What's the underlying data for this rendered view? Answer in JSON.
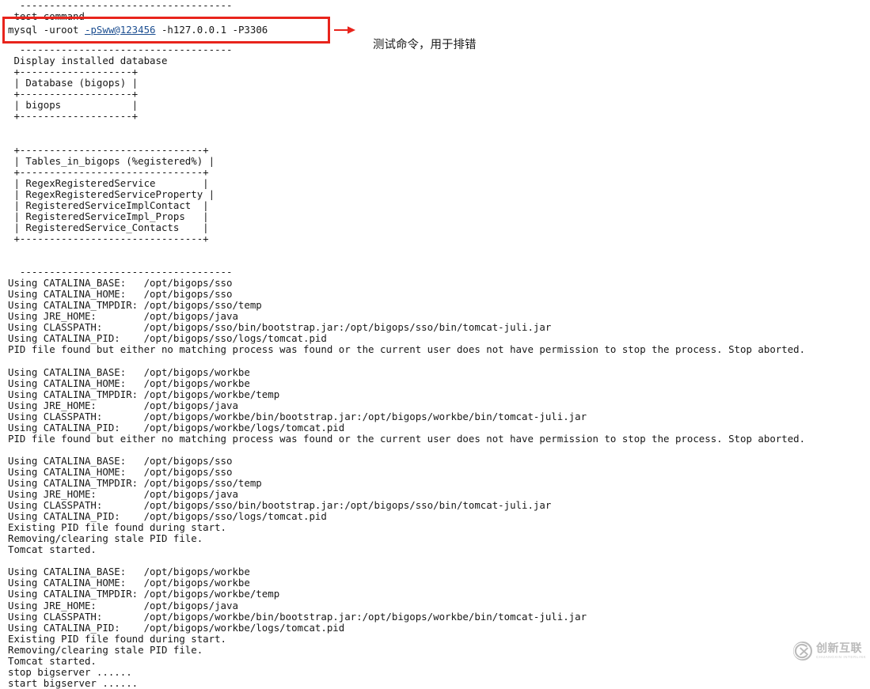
{
  "window": {
    "background_color": "#ffffff",
    "text_color": "#171717",
    "type": "terminal-output"
  },
  "annotation": {
    "box_color": "#e8241c",
    "arrow_color": "#e8241c",
    "note_text": "测试命令，用于排错"
  },
  "command": {
    "prefix": "mysql -uroot ",
    "link_text": "-pSww@123456",
    "suffix": " -h127.0.0.1 -P3306",
    "link_color": "#1d4f91"
  },
  "watermark": {
    "cn": "创新互联",
    "en": "CHUANGXIN INTERLINK",
    "color": "#8a8a8a"
  },
  "terminal": {
    "lines": [
      "  ------------------------------------",
      " test command",
      " mysql -uroot -pSww@123456 -h127.0.0.1 -P3306",
      "",
      "  ------------------------------------",
      " Display installed database",
      " +-------------------+",
      " | Database (bigops) |",
      " +-------------------+",
      " | bigops            |",
      " +-------------------+",
      "",
      "",
      " +-------------------------------+",
      " | Tables_in_bigops (%egistered%) |",
      " +-------------------------------+",
      " | RegexRegisteredService        |",
      " | RegexRegisteredServiceProperty |",
      " | RegisteredServiceImplContact  |",
      " | RegisteredServiceImpl_Props   |",
      " | RegisteredService_Contacts    |",
      " +-------------------------------+",
      "",
      "",
      "  ------------------------------------",
      "Using CATALINA_BASE:   /opt/bigops/sso",
      "Using CATALINA_HOME:   /opt/bigops/sso",
      "Using CATALINA_TMPDIR: /opt/bigops/sso/temp",
      "Using JRE_HOME:        /opt/bigops/java",
      "Using CLASSPATH:       /opt/bigops/sso/bin/bootstrap.jar:/opt/bigops/sso/bin/tomcat-juli.jar",
      "Using CATALINA_PID:    /opt/bigops/sso/logs/tomcat.pid",
      "PID file found but either no matching process was found or the current user does not have permission to stop the process. Stop aborted.",
      "",
      "Using CATALINA_BASE:   /opt/bigops/workbe",
      "Using CATALINA_HOME:   /opt/bigops/workbe",
      "Using CATALINA_TMPDIR: /opt/bigops/workbe/temp",
      "Using JRE_HOME:        /opt/bigops/java",
      "Using CLASSPATH:       /opt/bigops/workbe/bin/bootstrap.jar:/opt/bigops/workbe/bin/tomcat-juli.jar",
      "Using CATALINA_PID:    /opt/bigops/workbe/logs/tomcat.pid",
      "PID file found but either no matching process was found or the current user does not have permission to stop the process. Stop aborted.",
      "",
      "Using CATALINA_BASE:   /opt/bigops/sso",
      "Using CATALINA_HOME:   /opt/bigops/sso",
      "Using CATALINA_TMPDIR: /opt/bigops/sso/temp",
      "Using JRE_HOME:        /opt/bigops/java",
      "Using CLASSPATH:       /opt/bigops/sso/bin/bootstrap.jar:/opt/bigops/sso/bin/tomcat-juli.jar",
      "Using CATALINA_PID:    /opt/bigops/sso/logs/tomcat.pid",
      "Existing PID file found during start.",
      "Removing/clearing stale PID file.",
      "Tomcat started.",
      "",
      "Using CATALINA_BASE:   /opt/bigops/workbe",
      "Using CATALINA_HOME:   /opt/bigops/workbe",
      "Using CATALINA_TMPDIR: /opt/bigops/workbe/temp",
      "Using JRE_HOME:        /opt/bigops/java",
      "Using CLASSPATH:       /opt/bigops/workbe/bin/bootstrap.jar:/opt/bigops/workbe/bin/tomcat-juli.jar",
      "Using CATALINA_PID:    /opt/bigops/workbe/logs/tomcat.pid",
      "Existing PID file found during start.",
      "Removing/clearing stale PID file.",
      "Tomcat started.",
      "stop bigserver ......",
      "start bigserver ......"
    ]
  }
}
